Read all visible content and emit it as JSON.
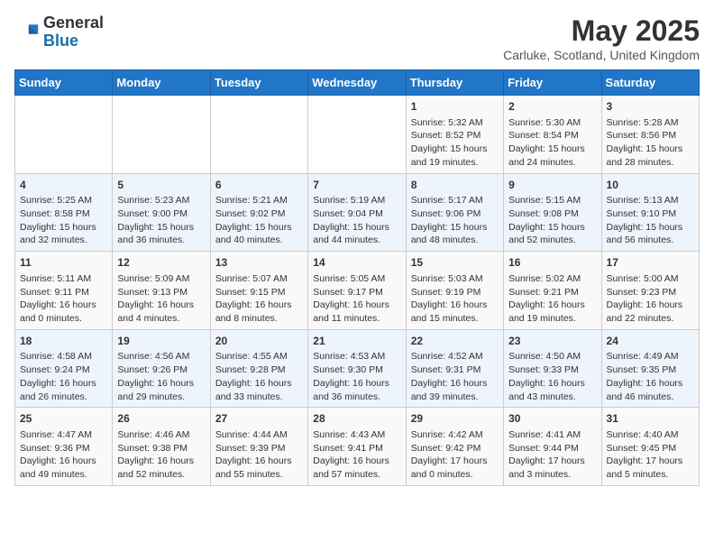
{
  "logo": {
    "general": "General",
    "blue": "Blue"
  },
  "title": "May 2025",
  "subtitle": "Carluke, Scotland, United Kingdom",
  "days_of_week": [
    "Sunday",
    "Monday",
    "Tuesday",
    "Wednesday",
    "Thursday",
    "Friday",
    "Saturday"
  ],
  "weeks": [
    [
      {
        "day": "",
        "info": ""
      },
      {
        "day": "",
        "info": ""
      },
      {
        "day": "",
        "info": ""
      },
      {
        "day": "",
        "info": ""
      },
      {
        "day": "1",
        "info": "Sunrise: 5:32 AM\nSunset: 8:52 PM\nDaylight: 15 hours and 19 minutes."
      },
      {
        "day": "2",
        "info": "Sunrise: 5:30 AM\nSunset: 8:54 PM\nDaylight: 15 hours and 24 minutes."
      },
      {
        "day": "3",
        "info": "Sunrise: 5:28 AM\nSunset: 8:56 PM\nDaylight: 15 hours and 28 minutes."
      }
    ],
    [
      {
        "day": "4",
        "info": "Sunrise: 5:25 AM\nSunset: 8:58 PM\nDaylight: 15 hours and 32 minutes."
      },
      {
        "day": "5",
        "info": "Sunrise: 5:23 AM\nSunset: 9:00 PM\nDaylight: 15 hours and 36 minutes."
      },
      {
        "day": "6",
        "info": "Sunrise: 5:21 AM\nSunset: 9:02 PM\nDaylight: 15 hours and 40 minutes."
      },
      {
        "day": "7",
        "info": "Sunrise: 5:19 AM\nSunset: 9:04 PM\nDaylight: 15 hours and 44 minutes."
      },
      {
        "day": "8",
        "info": "Sunrise: 5:17 AM\nSunset: 9:06 PM\nDaylight: 15 hours and 48 minutes."
      },
      {
        "day": "9",
        "info": "Sunrise: 5:15 AM\nSunset: 9:08 PM\nDaylight: 15 hours and 52 minutes."
      },
      {
        "day": "10",
        "info": "Sunrise: 5:13 AM\nSunset: 9:10 PM\nDaylight: 15 hours and 56 minutes."
      }
    ],
    [
      {
        "day": "11",
        "info": "Sunrise: 5:11 AM\nSunset: 9:11 PM\nDaylight: 16 hours and 0 minutes."
      },
      {
        "day": "12",
        "info": "Sunrise: 5:09 AM\nSunset: 9:13 PM\nDaylight: 16 hours and 4 minutes."
      },
      {
        "day": "13",
        "info": "Sunrise: 5:07 AM\nSunset: 9:15 PM\nDaylight: 16 hours and 8 minutes."
      },
      {
        "day": "14",
        "info": "Sunrise: 5:05 AM\nSunset: 9:17 PM\nDaylight: 16 hours and 11 minutes."
      },
      {
        "day": "15",
        "info": "Sunrise: 5:03 AM\nSunset: 9:19 PM\nDaylight: 16 hours and 15 minutes."
      },
      {
        "day": "16",
        "info": "Sunrise: 5:02 AM\nSunset: 9:21 PM\nDaylight: 16 hours and 19 minutes."
      },
      {
        "day": "17",
        "info": "Sunrise: 5:00 AM\nSunset: 9:23 PM\nDaylight: 16 hours and 22 minutes."
      }
    ],
    [
      {
        "day": "18",
        "info": "Sunrise: 4:58 AM\nSunset: 9:24 PM\nDaylight: 16 hours and 26 minutes."
      },
      {
        "day": "19",
        "info": "Sunrise: 4:56 AM\nSunset: 9:26 PM\nDaylight: 16 hours and 29 minutes."
      },
      {
        "day": "20",
        "info": "Sunrise: 4:55 AM\nSunset: 9:28 PM\nDaylight: 16 hours and 33 minutes."
      },
      {
        "day": "21",
        "info": "Sunrise: 4:53 AM\nSunset: 9:30 PM\nDaylight: 16 hours and 36 minutes."
      },
      {
        "day": "22",
        "info": "Sunrise: 4:52 AM\nSunset: 9:31 PM\nDaylight: 16 hours and 39 minutes."
      },
      {
        "day": "23",
        "info": "Sunrise: 4:50 AM\nSunset: 9:33 PM\nDaylight: 16 hours and 43 minutes."
      },
      {
        "day": "24",
        "info": "Sunrise: 4:49 AM\nSunset: 9:35 PM\nDaylight: 16 hours and 46 minutes."
      }
    ],
    [
      {
        "day": "25",
        "info": "Sunrise: 4:47 AM\nSunset: 9:36 PM\nDaylight: 16 hours and 49 minutes."
      },
      {
        "day": "26",
        "info": "Sunrise: 4:46 AM\nSunset: 9:38 PM\nDaylight: 16 hours and 52 minutes."
      },
      {
        "day": "27",
        "info": "Sunrise: 4:44 AM\nSunset: 9:39 PM\nDaylight: 16 hours and 55 minutes."
      },
      {
        "day": "28",
        "info": "Sunrise: 4:43 AM\nSunset: 9:41 PM\nDaylight: 16 hours and 57 minutes."
      },
      {
        "day": "29",
        "info": "Sunrise: 4:42 AM\nSunset: 9:42 PM\nDaylight: 17 hours and 0 minutes."
      },
      {
        "day": "30",
        "info": "Sunrise: 4:41 AM\nSunset: 9:44 PM\nDaylight: 17 hours and 3 minutes."
      },
      {
        "day": "31",
        "info": "Sunrise: 4:40 AM\nSunset: 9:45 PM\nDaylight: 17 hours and 5 minutes."
      }
    ]
  ]
}
